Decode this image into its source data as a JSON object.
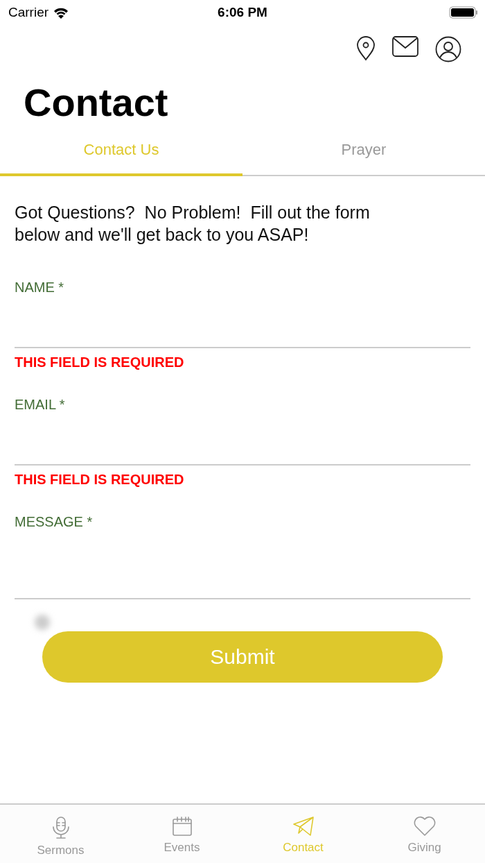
{
  "status_bar": {
    "carrier": "Carrier",
    "time": "6:06 PM"
  },
  "title": "Contact",
  "tabs": [
    {
      "label": "Contact Us",
      "selected": true
    },
    {
      "label": "Prayer",
      "selected": false
    }
  ],
  "intro": "Got Questions?  No Problem!  Fill out the form below and we'll get back to you ASAP!",
  "fields": [
    {
      "label": "NAME *",
      "error": "THIS FIELD IS REQUIRED",
      "kind": "line"
    },
    {
      "label": "EMAIL *",
      "error": "THIS FIELD IS REQUIRED",
      "kind": "line"
    },
    {
      "label": "MESSAGE *",
      "kind": "area"
    }
  ],
  "submit": "Submit",
  "tab_bar": [
    {
      "label": "Sermons",
      "selected": false
    },
    {
      "label": "Events",
      "selected": false
    },
    {
      "label": "Contact",
      "selected": true
    },
    {
      "label": "Giving",
      "selected": false
    }
  ]
}
